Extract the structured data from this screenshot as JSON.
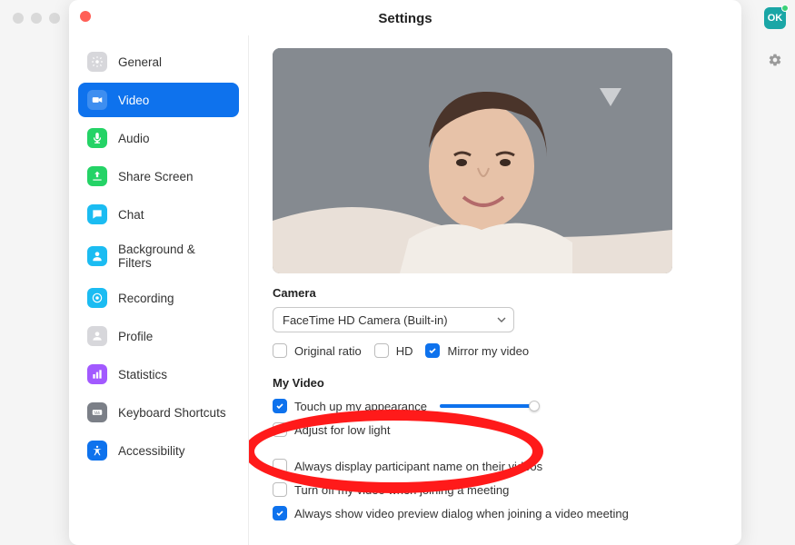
{
  "window": {
    "title": "Settings"
  },
  "topbar": {
    "avatar_initials": "OK"
  },
  "sidebar": {
    "items": [
      {
        "label": "General",
        "icon": "gear",
        "color": "#d7d7db",
        "active": false
      },
      {
        "label": "Video",
        "icon": "video",
        "color": "#0e72ed",
        "active": true
      },
      {
        "label": "Audio",
        "icon": "audio",
        "color": "#24d366",
        "active": false
      },
      {
        "label": "Share Screen",
        "icon": "share",
        "color": "#24d366",
        "active": false
      },
      {
        "label": "Chat",
        "icon": "chat",
        "color": "#1bbcf2",
        "active": false
      },
      {
        "label": "Background & Filters",
        "icon": "bgfilters",
        "color": "#1bbcf2",
        "active": false
      },
      {
        "label": "Recording",
        "icon": "recording",
        "color": "#1bbcf2",
        "active": false
      },
      {
        "label": "Profile",
        "icon": "profile",
        "color": "#d7d7db",
        "active": false
      },
      {
        "label": "Statistics",
        "icon": "stats",
        "color": "#a259ff",
        "active": false
      },
      {
        "label": "Keyboard Shortcuts",
        "icon": "keyboard",
        "color": "#7b7f87",
        "active": false
      },
      {
        "label": "Accessibility",
        "icon": "accessibility",
        "color": "#0e72ed",
        "active": false
      }
    ]
  },
  "camera": {
    "section_label": "Camera",
    "selected": "FaceTime HD Camera (Built-in)",
    "options": [
      {
        "label": "Original ratio",
        "checked": false
      },
      {
        "label": "HD",
        "checked": false
      },
      {
        "label": "Mirror my video",
        "checked": true
      }
    ]
  },
  "my_video": {
    "section_label": "My Video",
    "touch_up": {
      "label": "Touch up my appearance",
      "checked": true,
      "slider_percent": 95
    },
    "low_light": {
      "label": "Adjust for low light",
      "checked": false
    }
  },
  "other_options": [
    {
      "label": "Always display participant name on their videos",
      "checked": false
    },
    {
      "label": "Turn off my video when joining a meeting",
      "checked": false
    },
    {
      "label": "Always show video preview dialog when joining a video meeting",
      "checked": true
    }
  ]
}
